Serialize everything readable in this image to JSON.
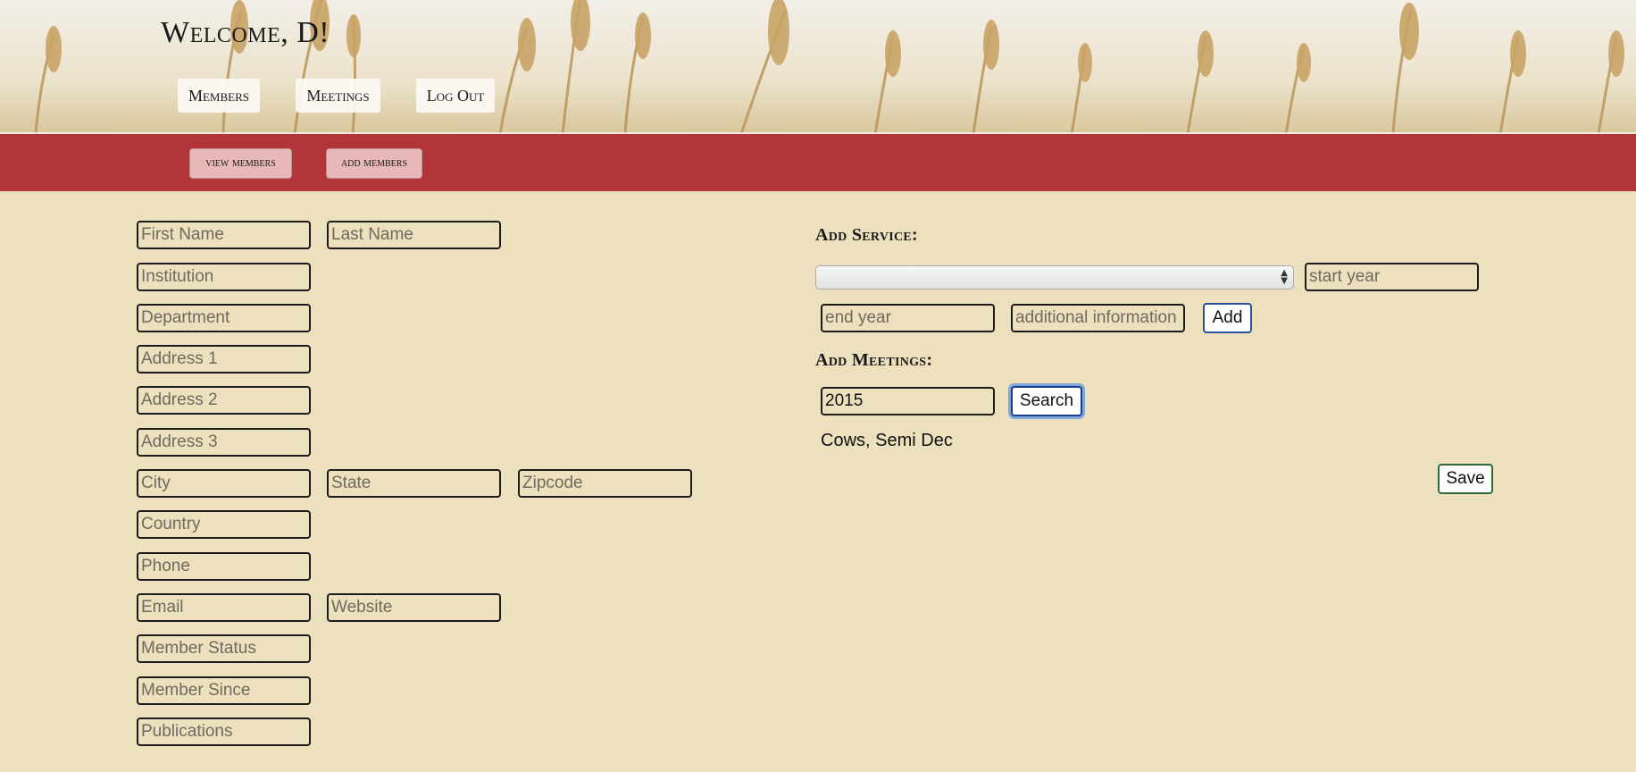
{
  "header": {
    "welcome": "Welcome, D!",
    "nav": {
      "members": "Members",
      "meetings": "Meetings",
      "logout": "Log Out"
    }
  },
  "subnav": {
    "view_members": "view members",
    "add_members": "add members"
  },
  "form": {
    "first_name": "First Name",
    "last_name": "Last Name",
    "institution": "Institution",
    "department": "Department",
    "address1": "Address 1",
    "address2": "Address 2",
    "address3": "Address 3",
    "city": "City",
    "state": "State",
    "zipcode": "Zipcode",
    "country": "Country",
    "phone": "Phone",
    "email": "Email",
    "website": "Website",
    "member_status": "Member Status",
    "member_since": "Member Since",
    "publications": "Publications"
  },
  "service": {
    "title": "Add Service:",
    "start_year_placeholder": "start year",
    "end_year_placeholder": "end year",
    "additional_info_placeholder": "additional information",
    "add_label": "Add"
  },
  "meetings": {
    "title": "Add Meetings:",
    "year_value": "2015",
    "search_label": "Search",
    "result": "Cows, Semi Dec"
  },
  "save_label": "Save",
  "colors": {
    "page_bg": "#ede0bd",
    "subnav_bg": "#b23539",
    "sub_button_bg": "#e8b8b8",
    "add_border": "#2a4f9e",
    "search_border": "#1a3d8a",
    "search_focus": "#7fa7dc",
    "save_border": "#2e6b3a"
  }
}
